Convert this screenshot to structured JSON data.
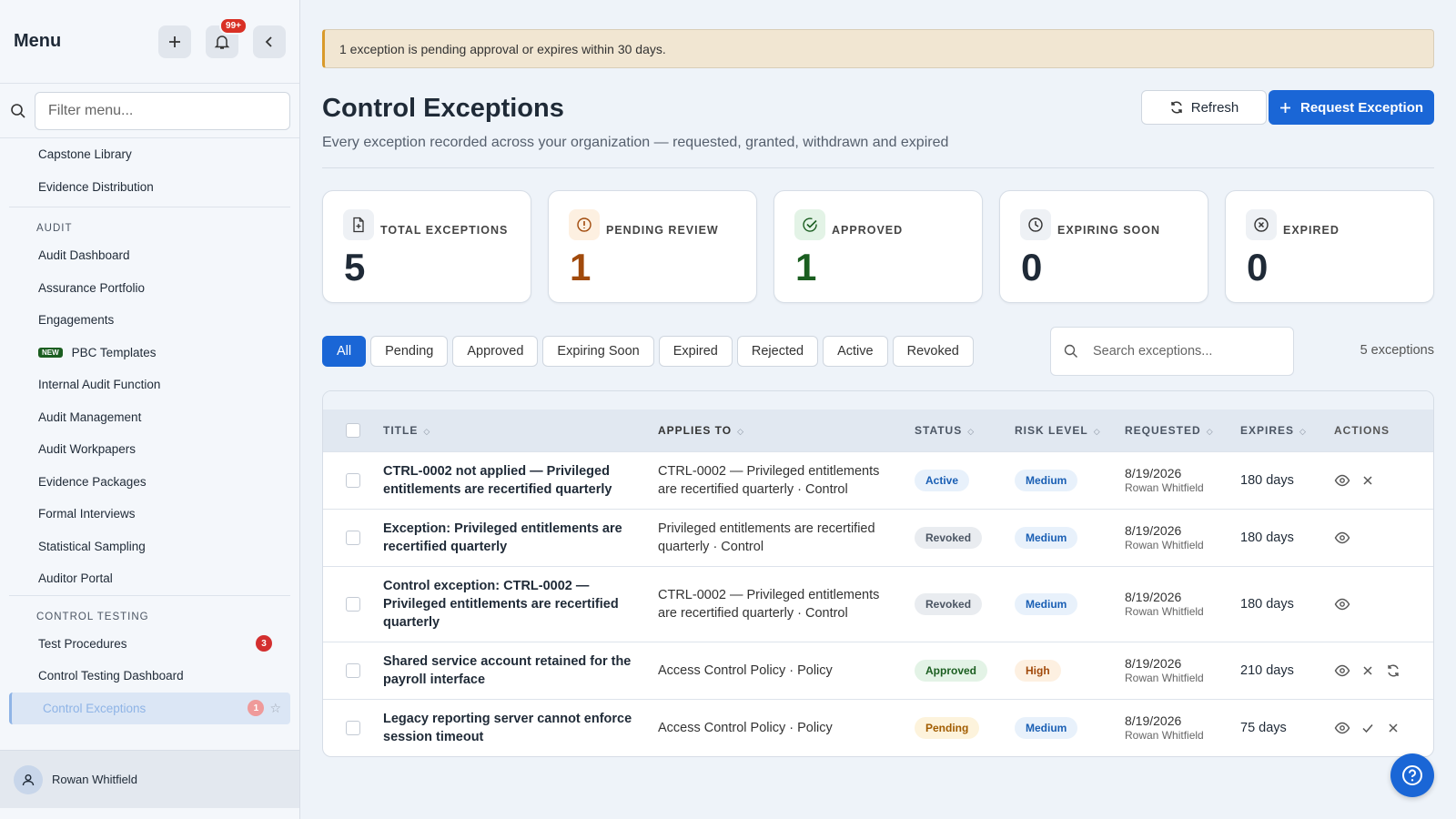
{
  "sidebar": {
    "title": "Menu",
    "notif_count": "99+",
    "filter_placeholder": "Filter menu...",
    "items_top": [
      "Capstone Library",
      "Evidence Distribution"
    ],
    "audit_section": "AUDIT",
    "audit_items": [
      "Audit Dashboard",
      "Assurance Portfolio",
      "Engagements",
      "PBC Templates",
      "Internal Audit Function",
      "Audit Management",
      "Audit Workpapers",
      "Evidence Packages",
      "Formal Interviews",
      "Statistical Sampling",
      "Auditor Portal"
    ],
    "new_badge": "NEW",
    "ct_section": "CONTROL TESTING",
    "ct_items": [
      "Test Procedures",
      "Control Testing Dashboard",
      "Control Exceptions"
    ],
    "test_procedures_count": "3",
    "control_exceptions_count": "1",
    "user_name": "Rowan Whitfield"
  },
  "banner": "1 exception is pending approval or expires within 30 days.",
  "header": {
    "title": "Control Exceptions",
    "subtitle": "Every exception recorded across your organization — requested, granted, withdrawn and expired",
    "refresh": "Refresh",
    "request": "Request Exception"
  },
  "stats": [
    {
      "label": "TOTAL EXCEPTIONS",
      "value": "5",
      "color": "#1f2a37",
      "bg": "#eef1f5"
    },
    {
      "label": "PENDING REVIEW",
      "value": "1",
      "color": "#a14a0c",
      "bg": "#fdf0e1"
    },
    {
      "label": "APPROVED",
      "value": "1",
      "color": "#1b5e20",
      "bg": "#e3f3e6"
    },
    {
      "label": "EXPIRING SOON",
      "value": "0",
      "color": "#1f2a37",
      "bg": "#eef1f5"
    },
    {
      "label": "EXPIRED",
      "value": "0",
      "color": "#1f2a37",
      "bg": "#eef1f5"
    }
  ],
  "filters": [
    "All",
    "Pending",
    "Approved",
    "Expiring Soon",
    "Expired",
    "Rejected",
    "Active",
    "Revoked"
  ],
  "search_placeholder": "Search exceptions...",
  "count_text": "5 exceptions",
  "table": {
    "headers": [
      "TITLE",
      "APPLIES TO",
      "STATUS",
      "RISK LEVEL",
      "REQUESTED",
      "EXPIRES",
      "ACTIONS"
    ],
    "rows": [
      {
        "title": "CTRL-0002 not applied — Privileged entitlements are recertified quarterly",
        "applies": "CTRL-0002 — Privileged entitlements are recertified quarterly · Control",
        "status": "Active",
        "risk": "Medium",
        "date": "8/19/2026",
        "by": "Rowan Whitfield",
        "expires": "180 days"
      },
      {
        "title": "Exception: Privileged entitlements are recertified quarterly",
        "applies": "Privileged entitlements are recertified quarterly · Control",
        "status": "Revoked",
        "risk": "Medium",
        "date": "8/19/2026",
        "by": "Rowan Whitfield",
        "expires": "180 days"
      },
      {
        "title": "Control exception: CTRL-0002 — Privileged entitlements are recertified quarterly",
        "applies": "CTRL-0002 — Privileged entitlements are recertified quarterly · Control",
        "status": "Revoked",
        "risk": "Medium",
        "date": "8/19/2026",
        "by": "Rowan Whitfield",
        "expires": "180 days"
      },
      {
        "title": "Shared service account retained for the payroll interface",
        "applies": "Access Control Policy · Policy",
        "status": "Approved",
        "risk": "High",
        "date": "8/19/2026",
        "by": "Rowan Whitfield",
        "expires": "210 days"
      },
      {
        "title": "Legacy reporting server cannot enforce session timeout",
        "applies": "Access Control Policy · Policy",
        "status": "Pending",
        "risk": "Medium",
        "date": "8/19/2026",
        "by": "Rowan Whitfield",
        "expires": "75 days"
      }
    ]
  }
}
